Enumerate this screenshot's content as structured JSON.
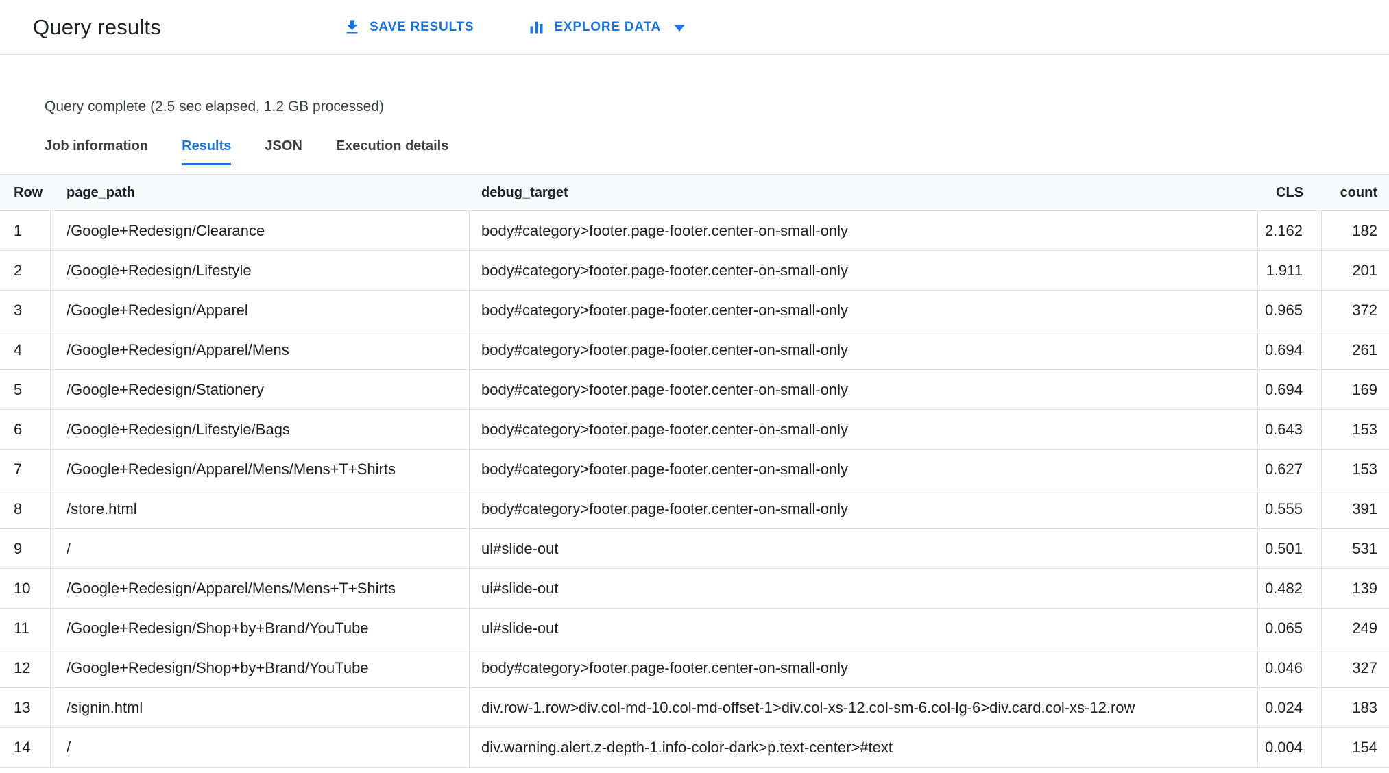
{
  "header": {
    "title": "Query results",
    "save_button_label": "SAVE RESULTS",
    "explore_button_label": "EXPLORE DATA"
  },
  "status_text": "Query complete (2.5 sec elapsed, 1.2 GB processed)",
  "tabs": [
    {
      "label": "Job information",
      "active": false
    },
    {
      "label": "Results",
      "active": true
    },
    {
      "label": "JSON",
      "active": false
    },
    {
      "label": "Execution details",
      "active": false
    }
  ],
  "table": {
    "columns": {
      "row": "Row",
      "page_path": "page_path",
      "debug_target": "debug_target",
      "cls": "CLS",
      "count": "count"
    },
    "rows": [
      {
        "row": "1",
        "page_path": "/Google+Redesign/Clearance",
        "debug_target": "body#category>footer.page-footer.center-on-small-only",
        "cls": "2.162",
        "count": "182"
      },
      {
        "row": "2",
        "page_path": "/Google+Redesign/Lifestyle",
        "debug_target": "body#category>footer.page-footer.center-on-small-only",
        "cls": "1.911",
        "count": "201"
      },
      {
        "row": "3",
        "page_path": "/Google+Redesign/Apparel",
        "debug_target": "body#category>footer.page-footer.center-on-small-only",
        "cls": "0.965",
        "count": "372"
      },
      {
        "row": "4",
        "page_path": "/Google+Redesign/Apparel/Mens",
        "debug_target": "body#category>footer.page-footer.center-on-small-only",
        "cls": "0.694",
        "count": "261"
      },
      {
        "row": "5",
        "page_path": "/Google+Redesign/Stationery",
        "debug_target": "body#category>footer.page-footer.center-on-small-only",
        "cls": "0.694",
        "count": "169"
      },
      {
        "row": "6",
        "page_path": "/Google+Redesign/Lifestyle/Bags",
        "debug_target": "body#category>footer.page-footer.center-on-small-only",
        "cls": "0.643",
        "count": "153"
      },
      {
        "row": "7",
        "page_path": "/Google+Redesign/Apparel/Mens/Mens+T+Shirts",
        "debug_target": "body#category>footer.page-footer.center-on-small-only",
        "cls": "0.627",
        "count": "153"
      },
      {
        "row": "8",
        "page_path": "/store.html",
        "debug_target": "body#category>footer.page-footer.center-on-small-only",
        "cls": "0.555",
        "count": "391"
      },
      {
        "row": "9",
        "page_path": "/",
        "debug_target": "ul#slide-out",
        "cls": "0.501",
        "count": "531"
      },
      {
        "row": "10",
        "page_path": "/Google+Redesign/Apparel/Mens/Mens+T+Shirts",
        "debug_target": "ul#slide-out",
        "cls": "0.482",
        "count": "139"
      },
      {
        "row": "11",
        "page_path": "/Google+Redesign/Shop+by+Brand/YouTube",
        "debug_target": "ul#slide-out",
        "cls": "0.065",
        "count": "249"
      },
      {
        "row": "12",
        "page_path": "/Google+Redesign/Shop+by+Brand/YouTube",
        "debug_target": "body#category>footer.page-footer.center-on-small-only",
        "cls": "0.046",
        "count": "327"
      },
      {
        "row": "13",
        "page_path": "/signin.html",
        "debug_target": "div.row-1.row>div.col-md-10.col-md-offset-1>div.col-xs-12.col-sm-6.col-lg-6>div.card.col-xs-12.row",
        "cls": "0.024",
        "count": "183"
      },
      {
        "row": "14",
        "page_path": "/",
        "debug_target": "div.warning.alert.z-depth-1.info-color-dark>p.text-center>#text",
        "cls": "0.004",
        "count": "154"
      }
    ]
  },
  "colors": {
    "accent": "#1a73e8",
    "text_primary": "#202124",
    "text_secondary": "#3c4043",
    "border": "#e0e0e0",
    "table_header_bg": "#f8f9fa"
  }
}
